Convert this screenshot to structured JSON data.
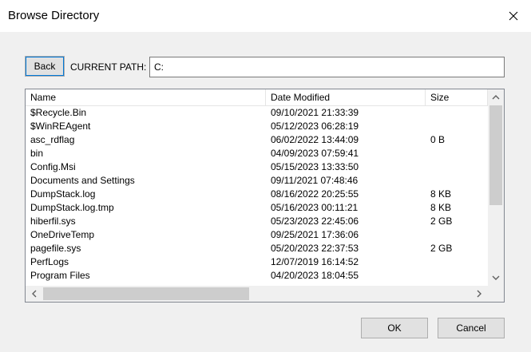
{
  "window": {
    "title": "Browse Directory"
  },
  "toolbar": {
    "back_label": "Back",
    "path_label": "CURRENT PATH:",
    "path_value": "C:"
  },
  "list": {
    "columns": [
      "Name",
      "Date Modified",
      "Size"
    ],
    "rows": [
      {
        "name": "$Recycle.Bin",
        "date": "09/10/2021 21:33:39",
        "size": ""
      },
      {
        "name": "$WinREAgent",
        "date": "05/12/2023 06:28:19",
        "size": ""
      },
      {
        "name": "asc_rdflag",
        "date": "06/02/2022 13:44:09",
        "size": "0 B"
      },
      {
        "name": "bin",
        "date": "04/09/2023 07:59:41",
        "size": ""
      },
      {
        "name": "Config.Msi",
        "date": "05/15/2023 13:33:50",
        "size": ""
      },
      {
        "name": "Documents and Settings",
        "date": "09/11/2021 07:48:46",
        "size": ""
      },
      {
        "name": "DumpStack.log",
        "date": "08/16/2022 20:25:55",
        "size": "8 KB"
      },
      {
        "name": "DumpStack.log.tmp",
        "date": "05/16/2023 00:11:21",
        "size": "8 KB"
      },
      {
        "name": "hiberfil.sys",
        "date": "05/23/2023 22:45:06",
        "size": "2 GB"
      },
      {
        "name": "OneDriveTemp",
        "date": "09/25/2021 17:36:06",
        "size": ""
      },
      {
        "name": "pagefile.sys",
        "date": "05/20/2023 22:37:53",
        "size": "2 GB"
      },
      {
        "name": "PerfLogs",
        "date": "12/07/2019 16:14:52",
        "size": ""
      },
      {
        "name": "Program Files",
        "date": "04/20/2023 18:04:55",
        "size": ""
      }
    ]
  },
  "buttons": {
    "ok_label": "OK",
    "cancel_label": "Cancel"
  },
  "icons": {
    "close": "close-icon",
    "scroll_up": "chevron-up-icon",
    "scroll_down": "chevron-down-icon",
    "scroll_left": "chevron-left-icon",
    "scroll_right": "chevron-right-icon"
  }
}
